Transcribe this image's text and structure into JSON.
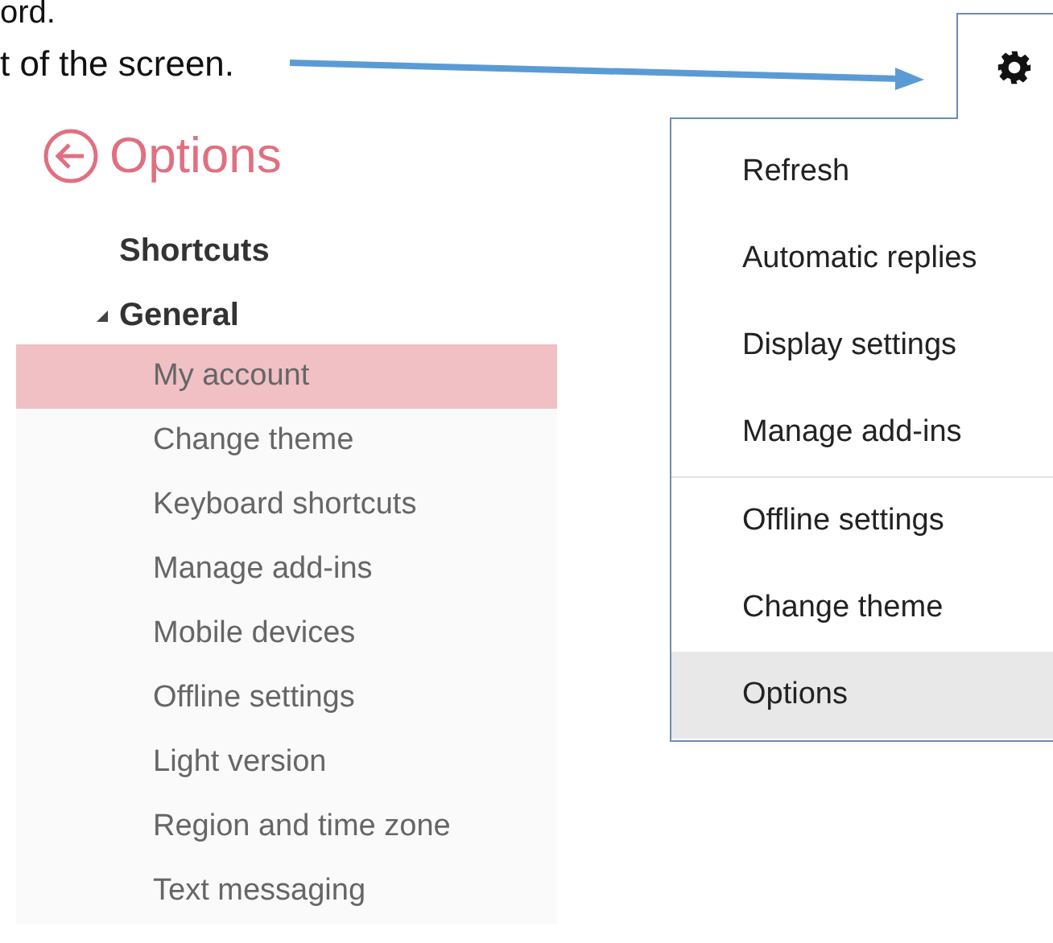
{
  "instructions": [
    {
      "text": "ord."
    },
    {
      "text": "t of the screen."
    }
  ],
  "options_panel": {
    "title": "Options",
    "nav": [
      {
        "label": "Shortcuts"
      },
      {
        "label": "General",
        "expanded": true,
        "children": [
          {
            "label": "My account",
            "selected": true
          },
          {
            "label": "Change theme",
            "selected": false
          },
          {
            "label": "Keyboard shortcuts",
            "selected": false
          },
          {
            "label": "Manage add-ins",
            "selected": false
          },
          {
            "label": "Mobile devices",
            "selected": false
          },
          {
            "label": "Offline settings",
            "selected": false
          },
          {
            "label": "Light version",
            "selected": false
          },
          {
            "label": "Region and time zone",
            "selected": false
          },
          {
            "label": "Text messaging",
            "selected": false
          }
        ]
      }
    ]
  },
  "settings_menu": {
    "groups": [
      [
        {
          "label": "Refresh",
          "selected": false
        },
        {
          "label": "Automatic replies",
          "selected": false
        },
        {
          "label": "Display settings",
          "selected": false
        },
        {
          "label": "Manage add-ins",
          "selected": false
        }
      ],
      [
        {
          "label": "Offline settings",
          "selected": false
        },
        {
          "label": "Change theme",
          "selected": false
        },
        {
          "label": "Options",
          "selected": true
        }
      ]
    ]
  }
}
